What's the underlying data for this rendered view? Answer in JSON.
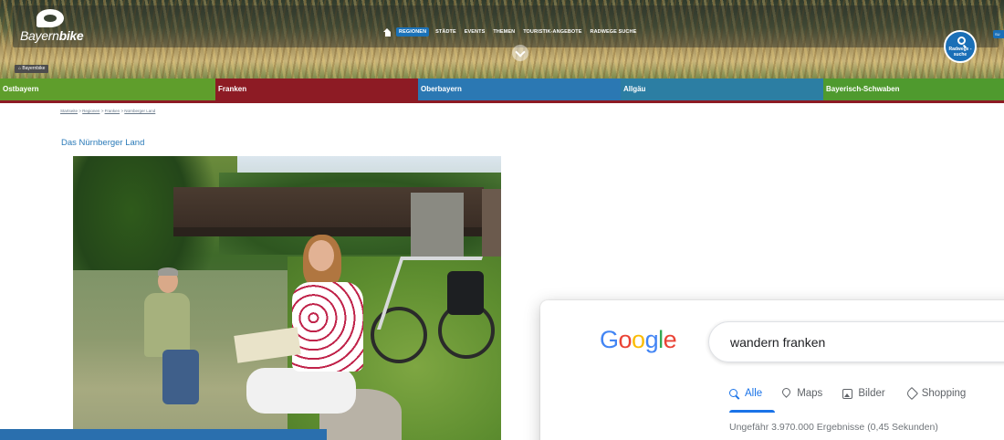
{
  "brand": {
    "logo_prefix": "Bayern",
    "logo_suffix": "bike"
  },
  "topnav": {
    "items": [
      {
        "label": "REGIONEN",
        "active": true
      },
      {
        "label": "STÄDTE",
        "active": false
      },
      {
        "label": "EVENTS",
        "active": false
      },
      {
        "label": "THEMEN",
        "active": false
      },
      {
        "label": "TOURISTIK-ANGEBOTE",
        "active": false
      },
      {
        "label": "RADWEGE SUCHE",
        "active": false
      }
    ]
  },
  "route_search": {
    "label": "Radwege -suche"
  },
  "search_tab": {
    "label": "SU"
  },
  "home_badge": {
    "label": "⌂ Bayernbike"
  },
  "regions": [
    {
      "label": "Ostbayern",
      "color": "#5f9e2c"
    },
    {
      "label": "Franken",
      "color": "#8d1b24"
    },
    {
      "label": "Oberbayern",
      "color": "#2b78b3"
    },
    {
      "label": "Allgäu",
      "color": "#2c7ea3"
    },
    {
      "label": "Bayerisch-Schwaben",
      "color": "#4f9a2e"
    }
  ],
  "breadcrumb": {
    "items": [
      "Startseite",
      "Regionen",
      "Franken",
      "Nürnberger Land"
    ],
    "separator": " > "
  },
  "page": {
    "title": "Das Nürnberger Land"
  },
  "google": {
    "logo_letters": [
      "G",
      "o",
      "o",
      "g",
      "l",
      "e"
    ],
    "query": "wandern franken",
    "tabs": [
      {
        "label": "Alle",
        "icon": "search-icon",
        "active": true
      },
      {
        "label": "Maps",
        "icon": "map-pin-icon",
        "active": false
      },
      {
        "label": "Bilder",
        "icon": "image-icon",
        "active": false
      },
      {
        "label": "Shopping",
        "icon": "tag-icon",
        "active": false
      }
    ],
    "result_stats": "Ungefähr 3.970.000 Ergebnisse (0,45 Sekunden)"
  },
  "colors": {
    "accent": "#1a73e8",
    "title_blue": "#2a7ab8",
    "region_underline": "#8d1b24"
  }
}
